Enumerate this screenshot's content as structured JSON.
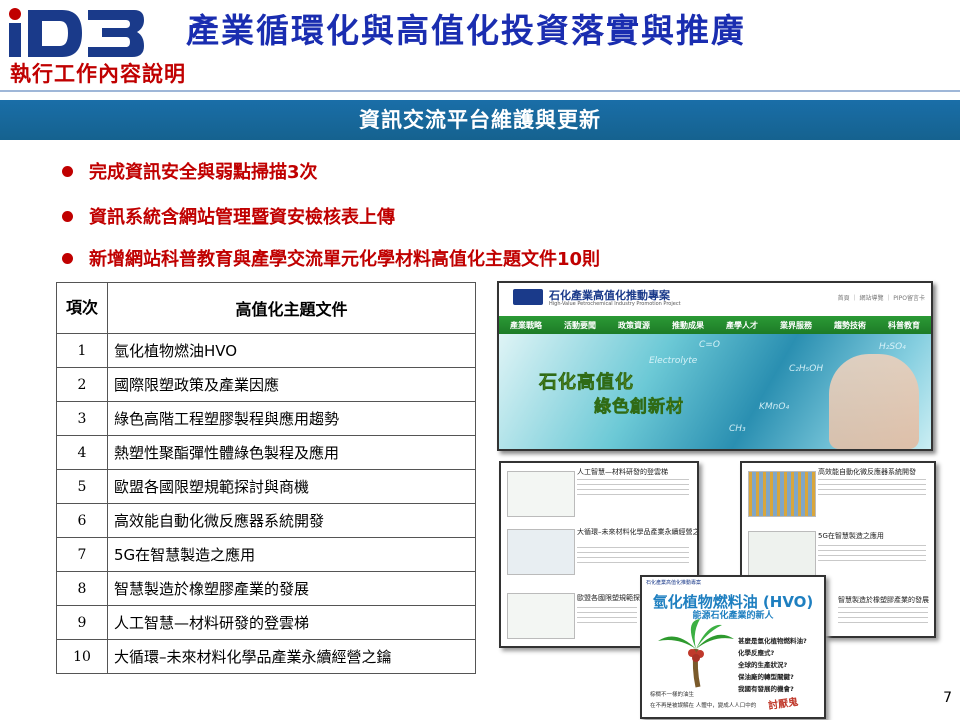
{
  "logo": {
    "text": "iD3"
  },
  "header": {
    "section_label": "執行工作內容說明",
    "title": "產業循環化與高值化投資落實與推廣"
  },
  "banner": {
    "title": "資訊交流平台維護與更新"
  },
  "bullets": [
    "完成資訊安全與弱點掃描3次",
    "資訊系統含網站管理暨資安檢核表上傳",
    "新增網站科普教育與產學交流單元化學材料高值化主題文件10則"
  ],
  "table": {
    "headers": [
      "項次",
      "高值化主題文件"
    ],
    "rows": [
      {
        "n": "1",
        "title": "氫化植物燃油HVO"
      },
      {
        "n": "2",
        "title": "國際限塑政策及產業因應"
      },
      {
        "n": "3",
        "title": "綠色高階工程塑膠製程與應用趨勢"
      },
      {
        "n": "4",
        "title": "熱塑性聚酯彈性體綠色製程及應用"
      },
      {
        "n": "5",
        "title": "歐盟各國限塑規範探討與商機"
      },
      {
        "n": "6",
        "title": "高效能自動化微反應器系統開發"
      },
      {
        "n": "7",
        "title": "5G在智慧製造之應用"
      },
      {
        "n": "8",
        "title": "智慧製造於橡塑膠產業的發展"
      },
      {
        "n": "9",
        "title": "人工智慧—材料研發的登雲梯"
      },
      {
        "n": "10",
        "title": "大循環–未來材料化學品產業永續經營之鑰"
      }
    ]
  },
  "website": {
    "site_title": "石化產業高值化推動專案",
    "site_subtitle": "High-Value Petrochemical Industry Promotion Project",
    "top_links": "首頁 ｜ 網站導覽 ｜ PIPO留言卡",
    "nav": [
      "產業戰略",
      "活動要聞",
      "政策資源",
      "推動成果",
      "產學人才",
      "業界服務",
      "趨勢技術",
      "科普教育"
    ],
    "hero_line1": "石化高值化",
    "hero_line2": "綠色創新材",
    "formulas": [
      "C=O",
      "H₂SO₄",
      "Electrolyte",
      "KMnO₄",
      "CH₃",
      "C₂H₅OH"
    ]
  },
  "card1": {
    "items": [
      {
        "title": "人工智慧—材料研發的登雲梯"
      },
      {
        "title": "大循環–未來材料化學品產業永續經營之鑰"
      },
      {
        "title": "歐盟各國限塑規範探討與商機"
      }
    ]
  },
  "card2": {
    "items": [
      {
        "title": "高效能自動化微反應器系統開發"
      },
      {
        "title": "5G在智慧製造之應用"
      },
      {
        "title": "智慧製造於橡塑膠產業的發展"
      }
    ]
  },
  "card3": {
    "title": "氫化植物燃料油 (HVO)",
    "subtitle": "能源石化產業的新人",
    "questions": [
      "甚麼是氫化植物燃料油?",
      "化學反應式?",
      "全球的生產狀況?",
      "保油廠的轉型關鍵?",
      "我國有發展的機會?"
    ],
    "bottom_1": "棕櫚不一樣的油生",
    "bottom_2": "在不再是被誤解在 人體中，變成人人口中的",
    "bottom_tag": "討厭鬼"
  },
  "page_number": "7",
  "colors": {
    "accent_red": "#c00000",
    "title_blue": "#1a2db0",
    "banner_blue": "#1a6ea8",
    "site_green": "#2b9a35"
  }
}
